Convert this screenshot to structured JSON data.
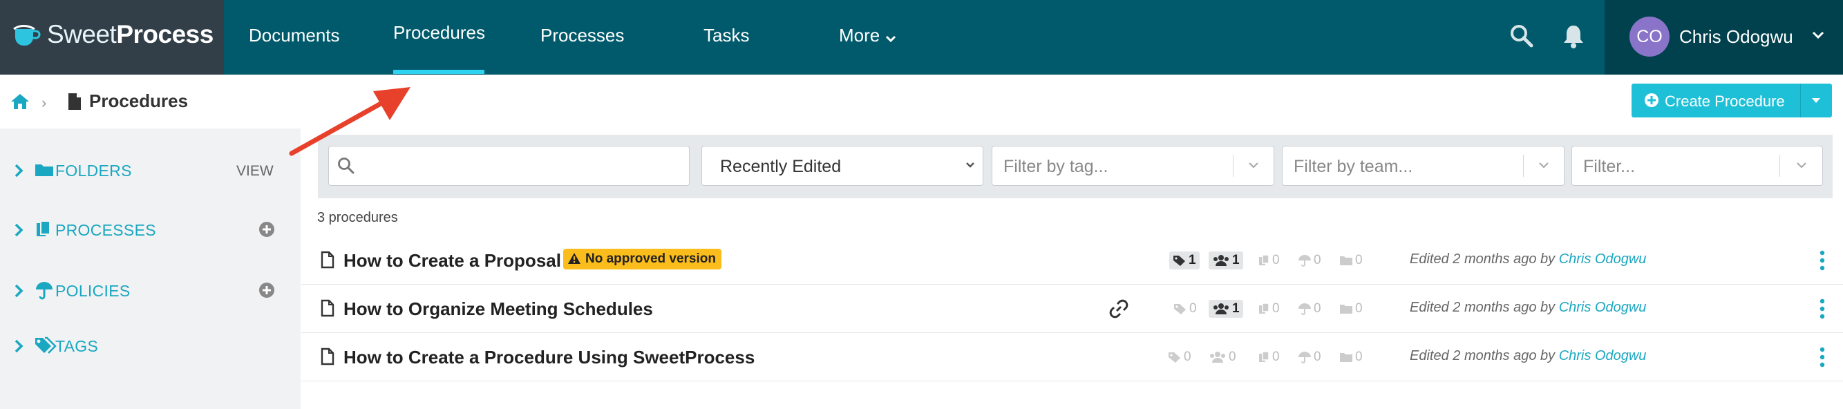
{
  "app": {
    "brand_light": "Sweet",
    "brand_bold": "Process"
  },
  "nav": {
    "items": [
      {
        "label": "Documents"
      },
      {
        "label": "Procedures",
        "active": true
      },
      {
        "label": "Processes"
      },
      {
        "label": "Tasks"
      },
      {
        "label": "More"
      }
    ]
  },
  "user": {
    "initials": "CO",
    "name": "Chris Odogwu"
  },
  "breadcrumb": {
    "title": "Procedures"
  },
  "create_button": {
    "label": "Create Procedure"
  },
  "sidebar": {
    "items": [
      {
        "label": "FOLDERS",
        "action": "VIEW"
      },
      {
        "label": "PROCESSES"
      },
      {
        "label": "POLICIES"
      },
      {
        "label": "TAGS"
      }
    ]
  },
  "filters": {
    "search_placeholder": "",
    "sort_value": "Recently Edited",
    "tag_placeholder": "Filter by tag...",
    "team_placeholder": "Filter by team...",
    "other_placeholder": "Filter..."
  },
  "list": {
    "count_label": "3 procedures",
    "rows": [
      {
        "title": "How to Create a Proposal",
        "badge": "No approved version",
        "has_link": false,
        "stats": {
          "tags": "1",
          "teams": "1",
          "processes": "0",
          "policies": "0",
          "folders": "0"
        },
        "edited_prefix": "Edited 2 months ago by ",
        "edited_by": "Chris Odogwu"
      },
      {
        "title": "How to Organize Meeting Schedules",
        "has_link": true,
        "stats": {
          "tags": "0",
          "teams": "1",
          "processes": "0",
          "policies": "0",
          "folders": "0"
        },
        "edited_prefix": "Edited 2 months ago by ",
        "edited_by": "Chris Odogwu"
      },
      {
        "title": "How to Create a Procedure Using SweetProcess",
        "has_link": false,
        "stats": {
          "tags": "0",
          "teams": "0",
          "processes": "0",
          "policies": "0",
          "folders": "0"
        },
        "edited_prefix": "Edited 2 months ago by ",
        "edited_by": "Chris Odogwu"
      }
    ]
  },
  "colors": {
    "nav_bg": "#005a6b",
    "logo_bg": "#333f48",
    "accent": "#1ec0d8",
    "badge": "#fbbd1c",
    "arrow": "#e8412b"
  }
}
